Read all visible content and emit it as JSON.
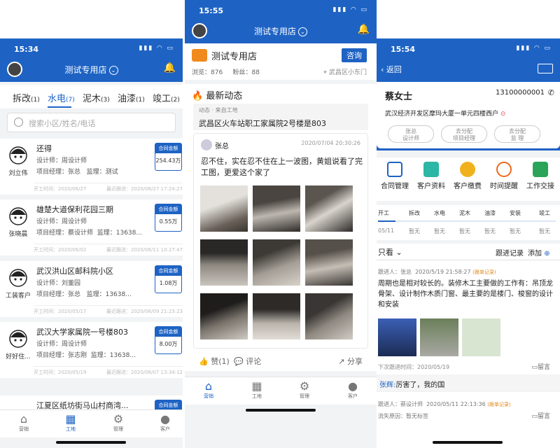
{
  "phone1": {
    "time": "15:34",
    "store_title": "测试专用店",
    "tabs": [
      {
        "label": "拆改",
        "count": "(1)"
      },
      {
        "label": "水电",
        "count": "(7)"
      },
      {
        "label": "泥木",
        "count": "(3)"
      },
      {
        "label": "油漆",
        "count": "(1)"
      },
      {
        "label": "竣工",
        "count": "(2)"
      }
    ],
    "search_placeholder": "搜索小区/姓名/电话",
    "amount_label": "合同金额",
    "cards": [
      {
        "name": "刘立伟",
        "title": "还得",
        "designer": "设计师：周设计师",
        "manager": "项目经理：张总",
        "supervisor": "监理：测试",
        "amount": "254.43万",
        "start": "开工时间：2020/06/27",
        "followup": "最近跟进：2020/06/27 17:24:27"
      },
      {
        "name": "张晓晨",
        "title": "雄楚大道保利花园三期",
        "designer": "设计师：周设计师",
        "manager": "项目经理：蔡设计师",
        "supervisor": "监理：13638...",
        "amount": "0.55万",
        "start": "开工时间：2020/06/02",
        "followup": "最近跟进：2020/06/11 10:27:47"
      },
      {
        "name": "工装客户",
        "title": "武汉洪山区邮科院小区",
        "designer": "设计师：刘董园",
        "manager": "项目经理：张总",
        "supervisor": "监理：13638...",
        "amount": "1.08万",
        "start": "开工时间：2020/05/17",
        "followup": "最近跟进：2020/06/09 21:23:23"
      },
      {
        "name": "好好住...",
        "title": "武汉大学家属院一号楼803",
        "designer": "设计师：周设计师",
        "manager": "项目经理：张志刚",
        "supervisor": "监理：13638...",
        "amount": "8.00万",
        "start": "开工时间：2020/05/19",
        "followup": "最近跟进：2020/06/07 13:34:12"
      },
      {
        "name": "",
        "title": "江夏区纸坊街马山村商湾...",
        "designer": "",
        "manager": "",
        "supervisor": "",
        "amount": "",
        "start": "",
        "followup": ""
      }
    ],
    "tabbar": [
      "营销",
      "工地",
      "管理",
      "客户"
    ]
  },
  "phone2": {
    "time": "15:55",
    "store_title": "测试专用店",
    "store_name": "测试专用店",
    "consult": "咨询",
    "views": "浏览：876",
    "fans": "粉丝：88",
    "location": "武昌区小东门",
    "section_title": "最新动态",
    "source": "动态 · 来自工地",
    "site": "武昌区火车站职工家属院2号楼是803",
    "author": "张总",
    "post_time": "2020/07/04 20:30:26",
    "post_text": "忍不住，实在忍不住在上一波图，黄姐说看了完工图，更爱这个家了",
    "likes": "赞(1)",
    "comment": "评论",
    "share": "分享",
    "tabbar": [
      "营销",
      "工地",
      "管理",
      "客户"
    ]
  },
  "phone3": {
    "time": "15:54",
    "back": "返回",
    "customer": "蔡女士",
    "phone": "13100000001",
    "address": "武汉经济开发区摩玛大厦一单元四楼西户",
    "pills": [
      {
        "top": "张总",
        "bottom": "设计师"
      },
      {
        "top": "去分配",
        "bottom": "项目经理"
      },
      {
        "top": "去分配",
        "bottom": "监 理"
      }
    ],
    "actions": [
      "合同管理",
      "客户资料",
      "客户缴费",
      "时间提醒",
      "工作交接"
    ],
    "stages": [
      "开工",
      "拆改",
      "水电",
      "泥木",
      "油漆",
      "安装",
      "竣工"
    ],
    "stage_values": [
      "05/11",
      "暂无",
      "暂无",
      "暂无",
      "暂无",
      "暂无",
      "暂无"
    ],
    "filter": "只看",
    "follow_title": "跟进记录",
    "add": "添加",
    "records": [
      {
        "person": "跟进人：张总",
        "time": "2020/5/19 21:58:27",
        "tag": "(跟单记录)",
        "text": "周期也是相对较长的。装修木工主要做的工作有：吊顶龙骨架、设计制作木质门窗、最主要的是楼门、梭窗的设计和安装",
        "next": "下次跟进时间：2020/05/19",
        "msg": "留言",
        "reply_name": "张辉:",
        "reply": "厉害了，我的国"
      },
      {
        "person": "跟进人：蔡设计师",
        "time": "2020/05/11 22:13:36",
        "tag": "(跟单记录)",
        "text": "流失原因：暂无标签",
        "msg": "留言"
      }
    ]
  }
}
